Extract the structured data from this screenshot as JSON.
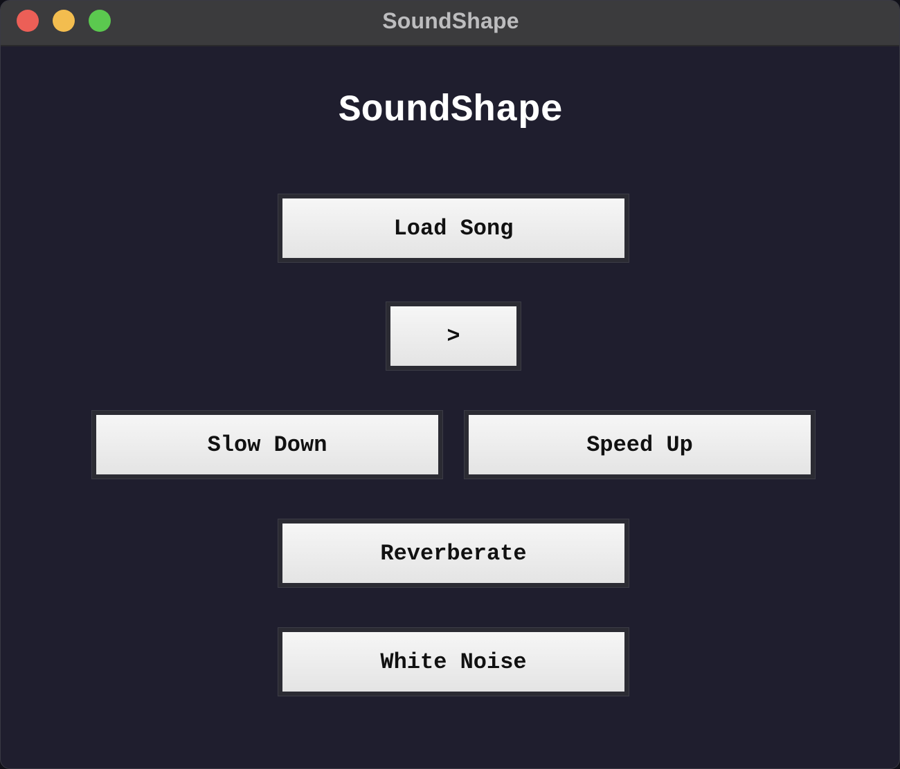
{
  "window": {
    "title": "SoundShape",
    "controls": {
      "close_color": "#ec5f57",
      "minimize_color": "#f3bd4f",
      "zoom_color": "#5bc94f"
    }
  },
  "app": {
    "heading": "SoundShape",
    "background_color": "#1f1e2e",
    "buttons": {
      "load_song": "Load Song",
      "play": ">",
      "slow_down": "Slow Down",
      "speed_up": "Speed Up",
      "reverberate": "Reverberate",
      "white_noise": "White Noise"
    }
  }
}
